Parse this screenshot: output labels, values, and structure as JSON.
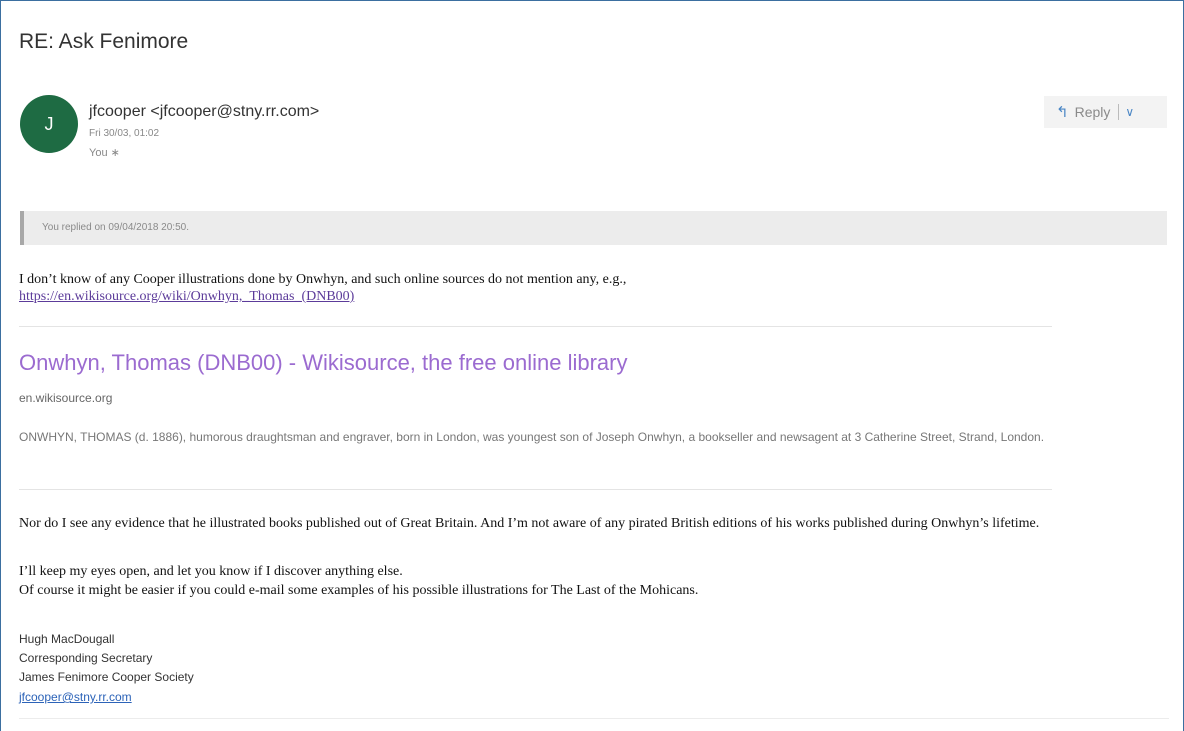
{
  "message": {
    "subject": "RE: Ask Fenimore",
    "sender": {
      "avatar_letter": "J",
      "avatar_color": "#1e6b43",
      "display": "jfcooper <jfcooper@stny.rr.com>",
      "date": "Fri 30/03, 01:02",
      "recipients": "You ∗"
    },
    "actions": {
      "reply_icon": "reply-arrow-icon",
      "reply_label": "Reply",
      "more_glyph": "∨"
    },
    "replied_notice": "You replied on 09/04/2018 20:50."
  },
  "body": {
    "line1": "I don’t know of any Cooper illustrations done by Onwhyn, and such online sources do not mention any, e.g.,",
    "link1": "https://en.wikisource.org/wiki/Onwhyn,_Thomas_(DNB00)",
    "preview": {
      "title": "Onwhyn, Thomas (DNB00) - Wikisource, the free online library",
      "domain": "en.wikisource.org",
      "description": "ONWHYN, THOMAS (d. 1886), humorous draughtsman and engraver, born in London, was youngest son of Joseph Onwhyn, a bookseller and newsagent at 3 Catherine Street, Strand, London."
    },
    "paragraph1": "Nor do I see any evidence that he illustrated books published out of Great Britain. And I’m not aware of any pirated British editions of his works published during Onwhyn’s lifetime.",
    "paragraph2": "I’ll keep my eyes open, and let you know if I discover anything else.",
    "paragraph3": "Of course it might be easier if you could e-mail some examples of his possible illustrations for The Last of the Mohicans."
  },
  "signature": {
    "name": "Hugh MacDougall",
    "title": "Corresponding Secretary",
    "org": "James Fenimore Cooper Society",
    "email": "jfcooper@stny.rr.com"
  },
  "colors": {
    "accent": "#4a86c5",
    "link_visited": "#5c3b9a",
    "preview_title": "#9b6bd0"
  }
}
